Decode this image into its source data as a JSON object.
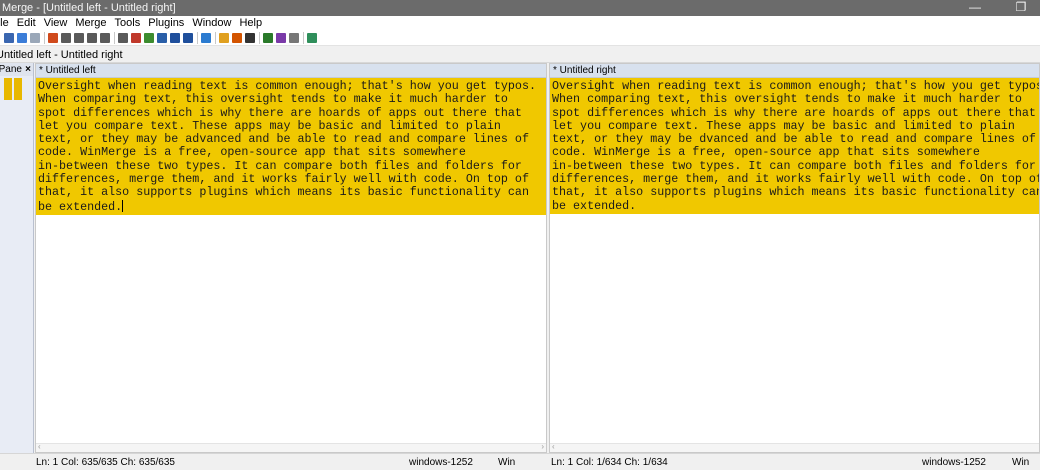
{
  "window": {
    "title": "Merge - [Untitled left - Untitled right]",
    "minimize_glyph": "—",
    "restore_glyph": "❐"
  },
  "menu": {
    "items": [
      "File",
      "Edit",
      "View",
      "Merge",
      "Tools",
      "Plugins",
      "Window",
      "Help"
    ]
  },
  "toolbar": {
    "icons": [
      {
        "name": "save-icon",
        "color": "#3a66b0"
      },
      {
        "name": "undo-icon",
        "color": "#3b7dd8"
      },
      {
        "name": "redo-icon",
        "color": "#9aa7b8"
      },
      {
        "name": "first-diff-icon",
        "color": "#d04a1c"
      },
      {
        "name": "prev-diff-icon",
        "color": "#5a5a5a"
      },
      {
        "name": "next-diff-icon",
        "color": "#5a5a5a"
      },
      {
        "name": "last-diff-icon",
        "color": "#5a5a5a"
      },
      {
        "name": "current-diff-icon",
        "color": "#5a5a5a"
      },
      {
        "name": "copy-right-icon",
        "color": "#5a5a5a"
      },
      {
        "name": "copy-left-icon",
        "color": "#c0392b"
      },
      {
        "name": "copy-right-advance-icon",
        "color": "#3d8c2f"
      },
      {
        "name": "copy-left-advance-icon",
        "color": "#2a5fa8"
      },
      {
        "name": "all-right-icon",
        "color": "#1f4f9c"
      },
      {
        "name": "all-left-icon",
        "color": "#1f4f9c"
      },
      {
        "name": "refresh-icon",
        "color": "#2b7bd0"
      },
      {
        "name": "options-icon",
        "color": "#e0a020"
      },
      {
        "name": "filter-icon",
        "color": "#d35400"
      },
      {
        "name": "dropdown-arrow-icon",
        "color": "#333333"
      },
      {
        "name": "compare-icon",
        "color": "#2a7a2a"
      },
      {
        "name": "merge-icon",
        "color": "#7a3aa8"
      },
      {
        "name": "pane-icon",
        "color": "#777777"
      },
      {
        "name": "script-icon",
        "color": "#2f8f5b"
      }
    ]
  },
  "doc_tab": {
    "label": "Untitled left - Untitled right"
  },
  "location_pane": {
    "header": "Location Pane",
    "close_glyph": "×",
    "colors": {
      "diff": "#e8b800"
    }
  },
  "left_pane": {
    "header": "* Untitled left",
    "lines": [
      "Oversight when reading text is common enough; that's how you get typos.",
      "When comparing text, this oversight tends to make it much harder to",
      "spot differences which is why there are hoards of apps out there that",
      "let you compare text. These apps may be basic and limited to plain",
      "text, or they may be advanced and be able to read and compare lines of",
      "code. WinMerge is a free, open-source app that sits somewhere",
      "in-between these two types. It can compare both files and folders for",
      "differences, merge them, and it works fairly well with code. On top of",
      "that, it also supports plugins which means its basic functionality can",
      "be extended."
    ]
  },
  "right_pane": {
    "header": "* Untitled right",
    "lines": [
      "Oversight when reading text is common enough; that's how you get typos.",
      "When comparing text, this oversight tends to make it much harder to",
      "spot differences which is why there are hoards of apps out there that",
      "let you compare text. These apps may be basic and limited to plain",
      "text, or they may be dvanced and be able to read and compare lines of",
      "code. WinMerge is a free, open-source app that sits somewhere",
      "in-between these two types. It can compare both files and folders for",
      "differences, merge them, and it works fairly well with code. On top of",
      "that, it also supports plugins which means its basic functionality can",
      "be extended."
    ]
  },
  "colors": {
    "diff_highlight": "#f0c800",
    "pane_header": "#d8e1ee"
  },
  "status": {
    "left_position": "Ln: 1  Col: 635/635  Ch: 635/635",
    "left_encoding": "windows-1252",
    "left_eol": "Win",
    "right_position": "Ln: 1  Col: 1/634  Ch: 1/634",
    "right_encoding": "windows-1252",
    "right_eol": "Win"
  }
}
